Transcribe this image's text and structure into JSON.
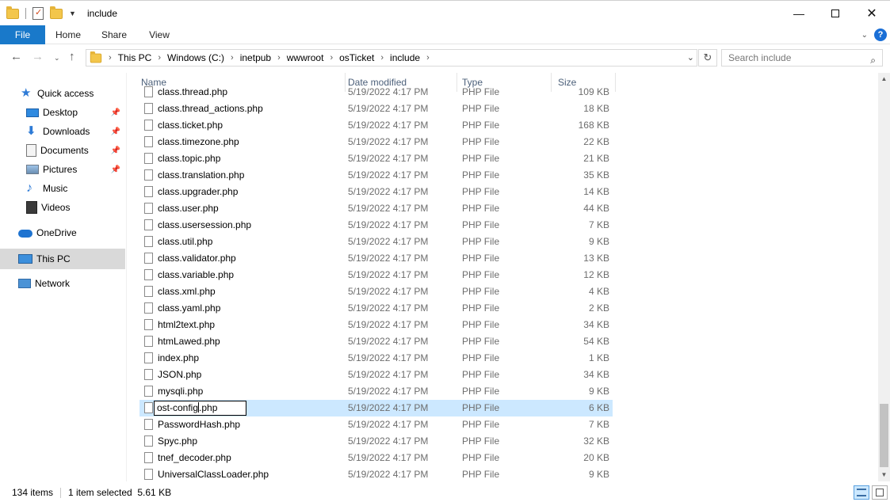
{
  "window": {
    "title": "include",
    "controls": [
      "minimize-icon",
      "maximize-icon",
      "close-icon"
    ]
  },
  "ribbon": {
    "tabs": [
      "File",
      "Home",
      "Share",
      "View"
    ]
  },
  "address": {
    "crumbs": [
      "This PC",
      "Windows (C:)",
      "inetpub",
      "wwwroot",
      "osTicket",
      "include"
    ],
    "search_placeholder": "Search include"
  },
  "sidebar": {
    "items": [
      {
        "label": "Quick access",
        "icon": "star-icon",
        "pinned": false
      },
      {
        "label": "Desktop",
        "icon": "desktop-icon",
        "pinned": true
      },
      {
        "label": "Downloads",
        "icon": "download-icon",
        "pinned": true
      },
      {
        "label": "Documents",
        "icon": "documents-icon",
        "pinned": true
      },
      {
        "label": "Pictures",
        "icon": "pictures-icon",
        "pinned": true
      },
      {
        "label": "Music",
        "icon": "music-icon",
        "pinned": false
      },
      {
        "label": "Videos",
        "icon": "videos-icon",
        "pinned": false
      },
      {
        "label": "OneDrive",
        "icon": "cloud-icon",
        "pinned": false
      },
      {
        "label": "This PC",
        "icon": "computer-icon",
        "pinned": false,
        "selected": true
      },
      {
        "label": "Network",
        "icon": "network-icon",
        "pinned": false
      }
    ]
  },
  "columns": [
    "Name",
    "Date modified",
    "Type",
    "Size"
  ],
  "files": [
    {
      "name": "class.thread.php",
      "date": "5/19/2022 4:17 PM",
      "type": "PHP File",
      "size": "109 KB"
    },
    {
      "name": "class.thread_actions.php",
      "date": "5/19/2022 4:17 PM",
      "type": "PHP File",
      "size": "18 KB"
    },
    {
      "name": "class.ticket.php",
      "date": "5/19/2022 4:17 PM",
      "type": "PHP File",
      "size": "168 KB"
    },
    {
      "name": "class.timezone.php",
      "date": "5/19/2022 4:17 PM",
      "type": "PHP File",
      "size": "22 KB"
    },
    {
      "name": "class.topic.php",
      "date": "5/19/2022 4:17 PM",
      "type": "PHP File",
      "size": "21 KB"
    },
    {
      "name": "class.translation.php",
      "date": "5/19/2022 4:17 PM",
      "type": "PHP File",
      "size": "35 KB"
    },
    {
      "name": "class.upgrader.php",
      "date": "5/19/2022 4:17 PM",
      "type": "PHP File",
      "size": "14 KB"
    },
    {
      "name": "class.user.php",
      "date": "5/19/2022 4:17 PM",
      "type": "PHP File",
      "size": "44 KB"
    },
    {
      "name": "class.usersession.php",
      "date": "5/19/2022 4:17 PM",
      "type": "PHP File",
      "size": "7 KB"
    },
    {
      "name": "class.util.php",
      "date": "5/19/2022 4:17 PM",
      "type": "PHP File",
      "size": "9 KB"
    },
    {
      "name": "class.validator.php",
      "date": "5/19/2022 4:17 PM",
      "type": "PHP File",
      "size": "13 KB"
    },
    {
      "name": "class.variable.php",
      "date": "5/19/2022 4:17 PM",
      "type": "PHP File",
      "size": "12 KB"
    },
    {
      "name": "class.xml.php",
      "date": "5/19/2022 4:17 PM",
      "type": "PHP File",
      "size": "4 KB"
    },
    {
      "name": "class.yaml.php",
      "date": "5/19/2022 4:17 PM",
      "type": "PHP File",
      "size": "2 KB"
    },
    {
      "name": "html2text.php",
      "date": "5/19/2022 4:17 PM",
      "type": "PHP File",
      "size": "34 KB"
    },
    {
      "name": "htmLawed.php",
      "date": "5/19/2022 4:17 PM",
      "type": "PHP File",
      "size": "54 KB"
    },
    {
      "name": "index.php",
      "date": "5/19/2022 4:17 PM",
      "type": "PHP File",
      "size": "1 KB"
    },
    {
      "name": "JSON.php",
      "date": "5/19/2022 4:17 PM",
      "type": "PHP File",
      "size": "34 KB"
    },
    {
      "name": "mysqli.php",
      "date": "5/19/2022 4:17 PM",
      "type": "PHP File",
      "size": "9 KB"
    },
    {
      "name": "ost-config.php",
      "date": "5/19/2022 4:17 PM",
      "type": "PHP File",
      "size": "6 KB",
      "selected": true,
      "renaming": true,
      "rename_value": "ost-config.php"
    },
    {
      "name": "PasswordHash.php",
      "date": "5/19/2022 4:17 PM",
      "type": "PHP File",
      "size": "7 KB"
    },
    {
      "name": "Spyc.php",
      "date": "5/19/2022 4:17 PM",
      "type": "PHP File",
      "size": "32 KB"
    },
    {
      "name": "tnef_decoder.php",
      "date": "5/19/2022 4:17 PM",
      "type": "PHP File",
      "size": "20 KB"
    },
    {
      "name": "UniversalClassLoader.php",
      "date": "5/19/2022 4:17 PM",
      "type": "PHP File",
      "size": "9 KB"
    }
  ],
  "status": {
    "item_count": "134 items",
    "selection": "1 item selected  5.61 KB"
  },
  "colors": {
    "accent": "#1979ca",
    "selection": "#cce8ff",
    "header_text": "#4c607a"
  }
}
